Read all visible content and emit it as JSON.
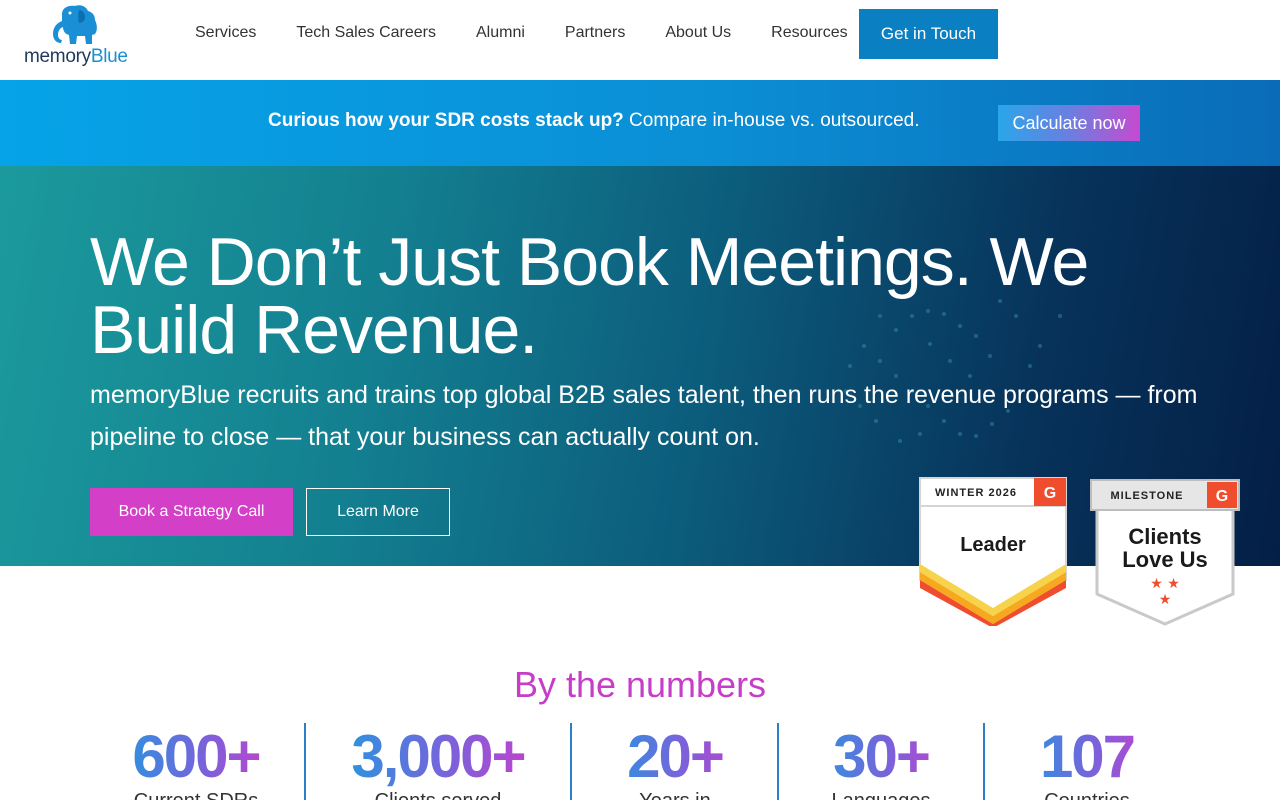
{
  "logo": {
    "text_a": "memory",
    "text_b": "Blue"
  },
  "nav": {
    "items": [
      "Services",
      "Tech Sales Careers",
      "Alumni",
      "Partners",
      "About Us",
      "Resources"
    ],
    "cta": "Get in Touch"
  },
  "banner": {
    "bold": "Curious how your SDR costs stack up?",
    "text": " Compare in-house vs. outsourced.",
    "button": "Calculate now"
  },
  "hero": {
    "title": "We Don’t Just Book Meetings. We Build Revenue.",
    "subtitle": "memoryBlue recruits and trains top global B2B sales talent, then runs the revenue programs — from pipeline to close — that your business can actually count on.",
    "primary_button": "Book a Strategy Call",
    "secondary_button": "Learn More"
  },
  "badges": {
    "leader": {
      "season": "WINTER 2026",
      "title": "Leader"
    },
    "clients": {
      "season": "MILESTONE",
      "line1": "Clients",
      "line2": "Love Us"
    }
  },
  "numbers": {
    "title": "By the numbers",
    "stats": [
      {
        "value": "600+",
        "label": "Current SDRs"
      },
      {
        "value": "3,000+",
        "label": "Clients served"
      },
      {
        "value": "20+",
        "label": "Years in"
      },
      {
        "value": "30+",
        "label": "Languages"
      },
      {
        "value": "107",
        "label": "Countries"
      }
    ]
  },
  "colors": {
    "brand_blue": "#0a7fc2",
    "accent_magenta": "#d43fc7",
    "g2_red": "#ef4d2d"
  }
}
